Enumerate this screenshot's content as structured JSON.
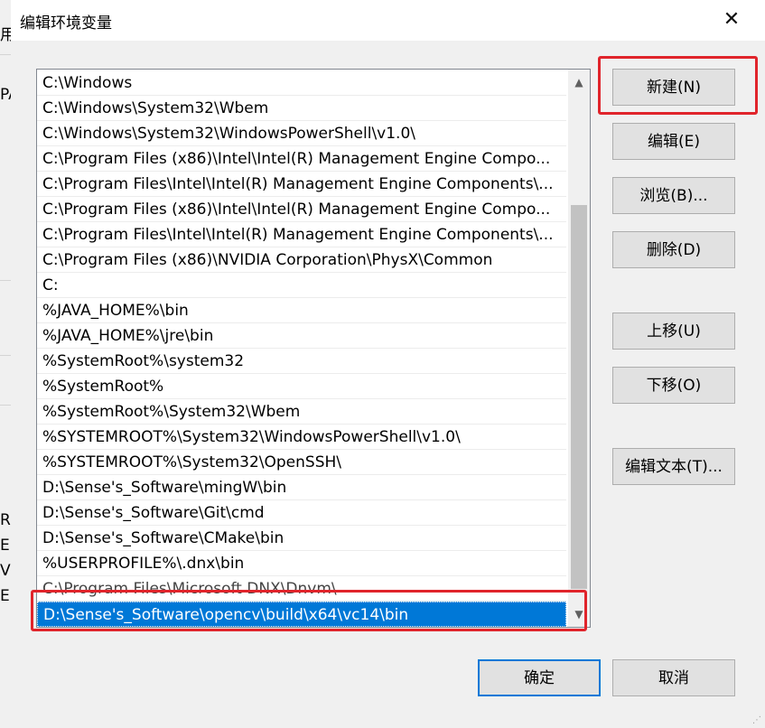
{
  "dialog": {
    "title": "编辑环境变量",
    "close_symbol": "✕"
  },
  "path_list": {
    "items": [
      "C:\\Windows",
      "C:\\Windows\\System32\\Wbem",
      "C:\\Windows\\System32\\WindowsPowerShell\\v1.0\\",
      "C:\\Program Files (x86)\\Intel\\Intel(R) Management Engine Compo...",
      "C:\\Program Files\\Intel\\Intel(R) Management Engine Components\\...",
      "C:\\Program Files (x86)\\Intel\\Intel(R) Management Engine Compo...",
      "C:\\Program Files\\Intel\\Intel(R) Management Engine Components\\...",
      "C:\\Program Files (x86)\\NVIDIA Corporation\\PhysX\\Common",
      "C:",
      "%JAVA_HOME%\\bin",
      "%JAVA_HOME%\\jre\\bin",
      "%SystemRoot%\\system32",
      "%SystemRoot%",
      "%SystemRoot%\\System32\\Wbem",
      "%SYSTEMROOT%\\System32\\WindowsPowerShell\\v1.0\\",
      "%SYSTEMROOT%\\System32\\OpenSSH\\",
      "D:\\Sense's_Software\\mingW\\bin",
      "D:\\Sense's_Software\\Git\\cmd",
      "D:\\Sense's_Software\\CMake\\bin",
      "%USERPROFILE%\\.dnx\\bin",
      "C:\\Program Files\\Microsoft DNX\\Dnvm\\",
      "D:\\Sense's_Software\\opencv\\build\\x64\\vc14\\bin"
    ],
    "selected_index": 21,
    "scroll_up_symbol": "▲",
    "scroll_down_symbol": "▼"
  },
  "buttons": {
    "new": "新建(N)",
    "edit": "编辑(E)",
    "browse": "浏览(B)...",
    "delete": "删除(D)",
    "move_up": "上移(U)",
    "move_down": "下移(O)",
    "edit_text": "编辑文本(T)...",
    "ok": "确定",
    "cancel": "取消"
  },
  "background_window": {
    "fragments": [
      "用",
      "PA",
      "R",
      "E",
      "V",
      "E"
    ]
  },
  "colors": {
    "selection": "#0078d7",
    "highlight_annotation": "#e0242b"
  }
}
